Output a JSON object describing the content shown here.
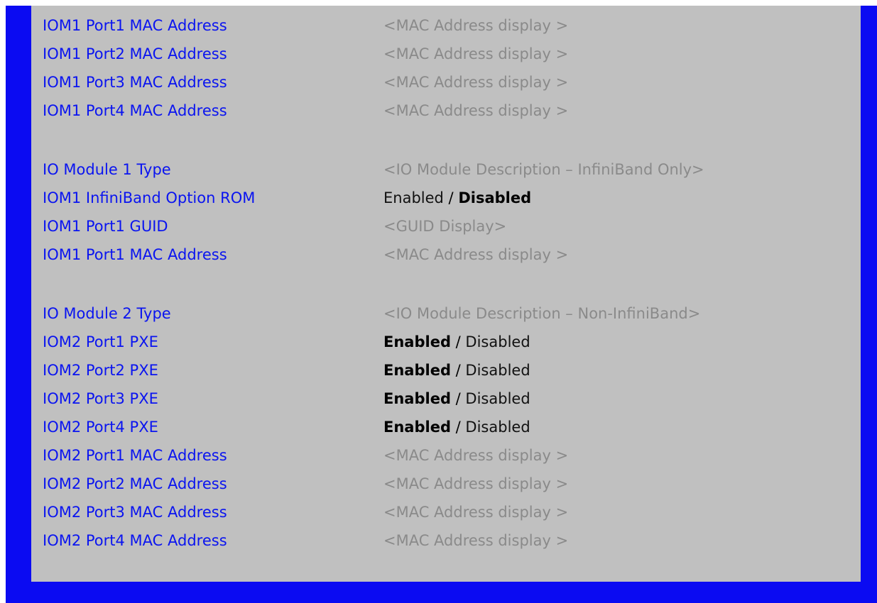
{
  "colors": {
    "frame": "#0b0bf2",
    "panel": "#c0c0c0",
    "label": "#0a14f0",
    "display_value": "#8a8a8a",
    "choice_value": "#111111"
  },
  "rows": [
    {
      "label": "IOM1 Port1 MAC Address",
      "value": "<MAC Address display >"
    },
    {
      "label": "IOM1 Port2 MAC Address",
      "value": "<MAC Address display >"
    },
    {
      "label": "IOM1 Port3 MAC Address",
      "value": "<MAC Address display >"
    },
    {
      "label": "IOM1 Port4 MAC Address",
      "value": "<MAC Address display >"
    },
    {
      "label": "IO Module 1 Type",
      "value": "<IO Module Description – InfiniBand Only>"
    },
    {
      "label": "IOM1 InfiniBand Option ROM",
      "option_a": "Enabled",
      "separator": " / ",
      "option_b": "Disabled",
      "selected": "Disabled"
    },
    {
      "label": "IOM1 Port1 GUID",
      "value": "<GUID Display>"
    },
    {
      "label": "IOM1 Port1 MAC Address",
      "value": "<MAC Address display >"
    },
    {
      "label": "IO Module 2 Type",
      "value": "<IO Module Description – Non-InfiniBand>"
    },
    {
      "label": "IOM2 Port1 PXE",
      "option_a": "Enabled",
      "separator": " / ",
      "option_b": "Disabled",
      "selected": "Enabled"
    },
    {
      "label": "IOM2 Port2 PXE",
      "option_a": "Enabled",
      "separator": " / ",
      "option_b": "Disabled",
      "selected": "Enabled"
    },
    {
      "label": "IOM2 Port3 PXE",
      "option_a": "Enabled",
      "separator": " / ",
      "option_b": "Disabled",
      "selected": "Enabled"
    },
    {
      "label": "IOM2 Port4 PXE",
      "option_a": "Enabled",
      "separator": " / ",
      "option_b": "Disabled",
      "selected": "Enabled"
    },
    {
      "label": "IOM2 Port1 MAC Address",
      "value": "<MAC Address display >"
    },
    {
      "label": "IOM2 Port2 MAC Address",
      "value": "<MAC Address display >"
    },
    {
      "label": "IOM2 Port3 MAC Address",
      "value": "<MAC Address display >"
    },
    {
      "label": "IOM2 Port4 MAC Address",
      "value": "<MAC Address display >"
    }
  ]
}
